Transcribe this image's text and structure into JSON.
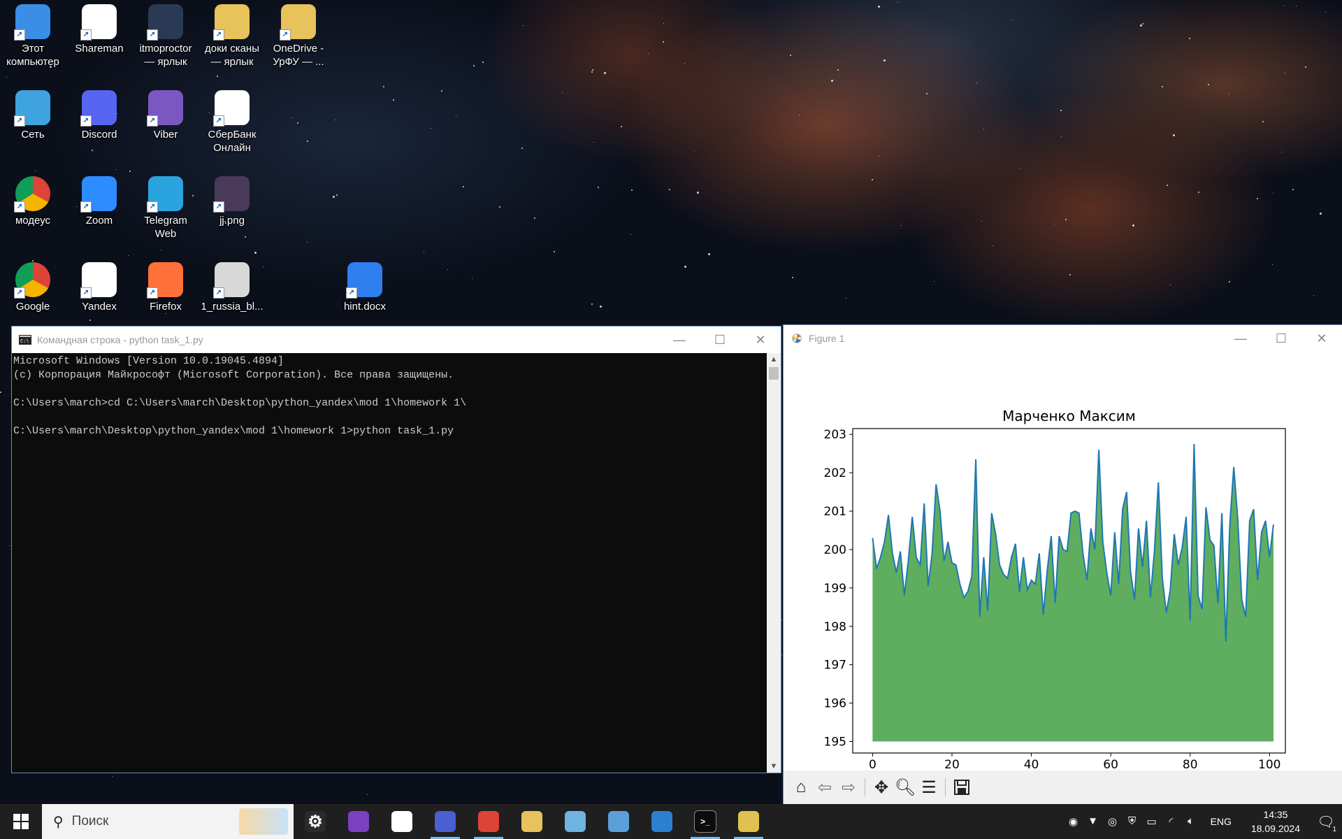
{
  "desktop_icons": [
    {
      "label": "Этот компьютер",
      "icon": "computer-icon",
      "color": "#3a8ee6"
    },
    {
      "label": "Shareman",
      "icon": "panda-icon",
      "color": "#ffffff"
    },
    {
      "label": "itmoproctor — ярлык",
      "icon": "compass-icon",
      "color": "#2a3a55"
    },
    {
      "label": "доки сканы — ярлык",
      "icon": "folder-icon",
      "color": "#e8c25a"
    },
    {
      "label": "OneDrive - УрФУ — ...",
      "icon": "onedrive-folder-icon",
      "color": "#e8c25a"
    },
    {
      "label": "Сеть",
      "icon": "network-globe-icon",
      "color": "#3fa3e0"
    },
    {
      "label": "Discord",
      "icon": "discord-icon",
      "color": "#5865f2"
    },
    {
      "label": "Viber",
      "icon": "viber-icon",
      "color": "#7d57c1"
    },
    {
      "label": "СберБанк Онлайн",
      "icon": "sberbank-icon",
      "color": "#ffffff"
    },
    {
      "label": "модеус",
      "icon": "chrome-icon",
      "color": "#db4437"
    },
    {
      "label": "Zoom",
      "icon": "zoom-icon",
      "color": "#2d8cff"
    },
    {
      "label": "Telegram Web",
      "icon": "telegram-icon",
      "color": "#2aa3df"
    },
    {
      "label": "jj.png",
      "icon": "image-thumbnail-icon",
      "color": "#4a3a5a"
    },
    {
      "label": "Google",
      "icon": "chrome-icon",
      "color": "#db4437"
    },
    {
      "label": "Yandex",
      "icon": "yandex-browser-icon",
      "color": "#ffffff"
    },
    {
      "label": "Firefox",
      "icon": "firefox-icon",
      "color": "#ff7139"
    },
    {
      "label": "1_russia_bl...",
      "icon": "settings-file-icon",
      "color": "#d8d8d8"
    },
    {
      "label": "hint.docx",
      "icon": "wps-writer-icon",
      "color": "#2f7ef0"
    }
  ],
  "cmd_window": {
    "title": "Командная строка - python  task_1.py",
    "lines": [
      "Microsoft Windows [Version 10.0.19045.4894]",
      "(c) Корпорация Майкрософт (Microsoft Corporation). Все права защищены.",
      "",
      "C:\\Users\\march>cd C:\\Users\\march\\Desktop\\python_yandex\\mod 1\\homework 1\\",
      "",
      "C:\\Users\\march\\Desktop\\python_yandex\\mod 1\\homework 1>python task_1.py"
    ]
  },
  "figure_window": {
    "title": "Figure 1",
    "toolbar": [
      "home-icon",
      "back-arrow-icon",
      "forward-arrow-icon",
      "pan-move-icon",
      "zoom-magnifier-icon",
      "configure-subplots-icon",
      "save-icon"
    ]
  },
  "chart_data": {
    "type": "area",
    "title": "Марченко Максим",
    "xlabel": "",
    "ylabel": "",
    "xlim": [
      -5,
      104
    ],
    "ylim": [
      194.7,
      203.15
    ],
    "xticks": [
      0,
      20,
      40,
      60,
      80,
      100
    ],
    "yticks": [
      195,
      196,
      197,
      198,
      199,
      200,
      201,
      202,
      203
    ],
    "baseline": 195,
    "line_color": "#1f77b4",
    "fill_color": "#5fae5f",
    "x_start": 0,
    "values": [
      200.3,
      199.5,
      199.8,
      200.2,
      200.9,
      199.9,
      199.4,
      199.95,
      198.8,
      199.7,
      200.85,
      199.8,
      199.6,
      201.2,
      199.05,
      199.9,
      201.7,
      201.0,
      199.7,
      200.2,
      199.65,
      199.6,
      199.1,
      198.75,
      198.9,
      199.3,
      202.35,
      198.25,
      199.8,
      198.4,
      200.95,
      200.4,
      199.6,
      199.35,
      199.25,
      199.8,
      200.15,
      198.9,
      199.8,
      198.95,
      199.2,
      199.1,
      199.9,
      198.3,
      199.45,
      200.35,
      198.6,
      200.35,
      200.0,
      199.95,
      200.95,
      201.0,
      200.95,
      199.9,
      199.2,
      200.55,
      200.0,
      202.6,
      200.2,
      199.4,
      198.8,
      200.45,
      199.1,
      201.05,
      201.5,
      199.4,
      198.7,
      200.55,
      199.55,
      200.75,
      198.75,
      199.95,
      201.75,
      199.25,
      198.35,
      198.95,
      200.4,
      199.6,
      200.05,
      200.85,
      198.15,
      202.75,
      198.8,
      198.45,
      201.1,
      200.25,
      200.1,
      198.6,
      200.95,
      197.6,
      200.65,
      202.15,
      200.8,
      198.7,
      198.25,
      200.75,
      201.05,
      199.2,
      200.45,
      200.75,
      199.8,
      200.65
    ]
  },
  "taskbar": {
    "search_placeholder": "Поиск",
    "apps": [
      {
        "icon": "settings-gear-icon",
        "color": "#2b2b2b",
        "active": false
      },
      {
        "icon": "visual-studio-icon",
        "color": "#7b3fc2",
        "active": false
      },
      {
        "icon": "sberbank-icon",
        "color": "#ffffff",
        "active": false
      },
      {
        "icon": "discord-chrome-icon",
        "color": "#4a5fd0",
        "active": true
      },
      {
        "icon": "chrome-profile-icon",
        "color": "#db4437",
        "active": true
      },
      {
        "icon": "file-explorer-icon",
        "color": "#e8c25a",
        "active": false
      },
      {
        "icon": "notepad-icon",
        "color": "#6fb3e0",
        "active": false
      },
      {
        "icon": "paint-icon",
        "color": "#5a9fd8",
        "active": false
      },
      {
        "icon": "photos-icon",
        "color": "#2d7fd0",
        "active": false
      },
      {
        "icon": "command-prompt-icon",
        "color": "#0c0c0c",
        "active": true
      },
      {
        "icon": "python-matplotlib-icon",
        "color": "#e0c050",
        "active": true
      }
    ],
    "tray_icons": [
      "discord-tray-icon",
      "antivirus-tray-icon",
      "steam-tray-icon",
      "security-shield-icon",
      "battery-icon",
      "wifi-icon",
      "volume-icon"
    ],
    "language": "ENG",
    "time": "14:35",
    "date": "18.09.2024",
    "notification_count": "1"
  }
}
